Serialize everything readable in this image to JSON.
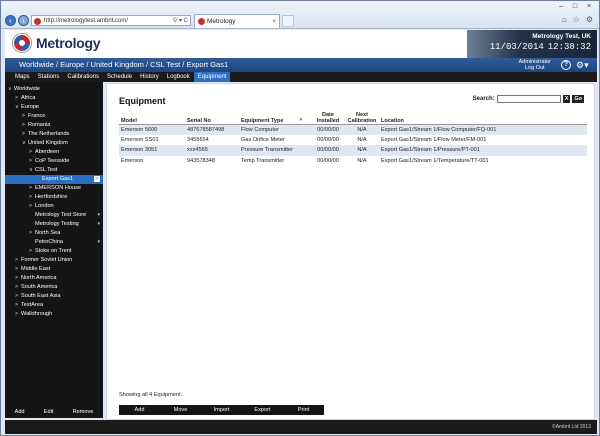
{
  "browser": {
    "url": "http://metrologytest.ambrit.com/",
    "addr_actions": "⚲ ▾ C",
    "tab_title": "Metrology",
    "tab_close": "×",
    "window_controls": [
      "–",
      "□",
      "×"
    ],
    "tools": [
      "⌂",
      "☆",
      "⚙"
    ]
  },
  "app": {
    "logo_text": "Metrology",
    "site_name": "Metrology Test, UK",
    "date": "11/03/2014",
    "time": "12:38:32"
  },
  "breadcrumb": "Worldwide / Europe / United Kingdom / CSL Test / Export Gas1",
  "user": {
    "name": "Administrator",
    "logout": "Log Out"
  },
  "menu": [
    "Maps",
    "Stations",
    "Calibrations",
    "Schedule",
    "History",
    "Logbook",
    "Equipment"
  ],
  "menu_active": "Equipment",
  "tree": [
    {
      "label": "Worldwide",
      "level": 0,
      "caret": "∨"
    },
    {
      "label": "Africa",
      "level": 1,
      "caret": ">"
    },
    {
      "label": "Europe",
      "level": 1,
      "caret": "∨"
    },
    {
      "label": "France",
      "level": 2,
      "caret": ">"
    },
    {
      "label": "Romania",
      "level": 2,
      "caret": ">"
    },
    {
      "label": "The Netherlands",
      "level": 2,
      "caret": ">"
    },
    {
      "label": "United Kingdom",
      "level": 2,
      "caret": "∨"
    },
    {
      "label": "Aberdeen",
      "level": 3,
      "caret": ">"
    },
    {
      "label": "CoP Teesside",
      "level": 3,
      "caret": ">"
    },
    {
      "label": "CSL Test",
      "level": 3,
      "caret": "∨"
    },
    {
      "label": "Export Gas1",
      "level": 4,
      "caret": "",
      "selected": true,
      "badge": ">"
    },
    {
      "label": "EMERSON House",
      "level": 3,
      "caret": ">"
    },
    {
      "label": "Hertfordshire",
      "level": 3,
      "caret": ">"
    },
    {
      "label": "London",
      "level": 3,
      "caret": ">"
    },
    {
      "label": "Metrology Test Store",
      "level": 3,
      "caret": "",
      "badge": "▾"
    },
    {
      "label": "Metrology Testing",
      "level": 3,
      "caret": "",
      "badge": "▾"
    },
    {
      "label": "North Sea",
      "level": 3,
      "caret": ">"
    },
    {
      "label": "PetroChina",
      "level": 3,
      "caret": "",
      "badge": "▾"
    },
    {
      "label": "Stoke on Trent",
      "level": 3,
      "caret": ">"
    },
    {
      "label": "Former Soviet Union",
      "level": 1,
      "caret": ">"
    },
    {
      "label": "Middle East",
      "level": 1,
      "caret": ">"
    },
    {
      "label": "North America",
      "level": 1,
      "caret": ">"
    },
    {
      "label": "South America",
      "level": 1,
      "caret": ">"
    },
    {
      "label": "South East Asia",
      "level": 1,
      "caret": ">"
    },
    {
      "label": "TestArea",
      "level": 1,
      "caret": ">"
    },
    {
      "label": "Walkthrough",
      "level": 1,
      "caret": ">"
    }
  ],
  "sidebar_buttons": [
    "Add",
    "Edit",
    "Remove"
  ],
  "page": {
    "title": "Equipment",
    "search_label": "Search:",
    "search_clear": "X",
    "search_go": "Go",
    "columns": [
      "Model",
      "Serial No",
      "Equipment Type",
      "Date Installed",
      "Next Calibration",
      "Location"
    ],
    "sort_icon": "^",
    "rows": [
      [
        "Emerson 5600",
        "487678587498",
        "Flow Computer",
        "00/00/00",
        "N/A",
        "Export Gas1/Stream 1/Flow Computer/FQ-001"
      ],
      [
        "Emerson SS01",
        "3455654",
        "Gas Orifice Meter",
        "00/00/00",
        "N/A",
        "Export Gas1/Stream 1/Flow Meter/FM-001"
      ],
      [
        "Emerson 3051",
        "xxx4565",
        "Pressure Transmitter",
        "00/00/00",
        "N/A",
        "Export Gas1/Stream 1/Pressure/PT-001"
      ],
      [
        "Emerson",
        "943578348",
        "Temp Transmitter",
        "00/00/00",
        "N/A",
        "Export Gas1/Stream 1/Temperature/TT-001"
      ]
    ],
    "showing": "Showing all 4 Equipment.",
    "actions": [
      "Add",
      "Move",
      "Import",
      "Export",
      "Print"
    ]
  },
  "footer": "©Ambrit Ltd 2013"
}
